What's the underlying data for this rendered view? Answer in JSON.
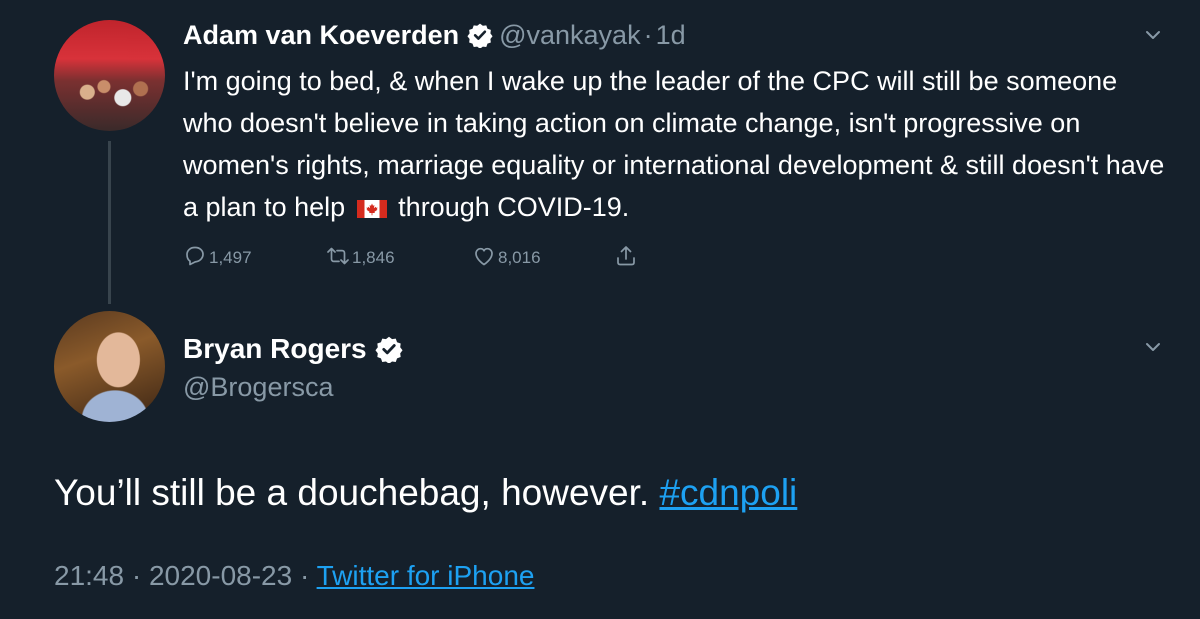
{
  "parent_tweet": {
    "display_name": "Adam van Koeverden",
    "handle": "@vankayak",
    "separator": "·",
    "time_ago": "1d",
    "text_before_flag": "I'm going to bed, & when I wake up the leader of the CPC will still be someone who doesn't believe in taking action on climate change, isn't progressive on women's rights, marriage equality or international development & still doesn't have a plan to help",
    "flag_icon": "canada-flag-icon",
    "text_after_flag": "through COVID-19.",
    "replies": "1,497",
    "retweets": "1,846",
    "likes": "8,016"
  },
  "reply_tweet": {
    "display_name": "Bryan Rogers",
    "handle": "@Brogersca",
    "text": "You’ll still be a douchebag, however.",
    "hashtag": "#cdnpoli",
    "time": "21:48",
    "separator1": "·",
    "date": "2020-08-23",
    "separator2": "·",
    "source": "Twitter for iPhone"
  },
  "colors": {
    "background": "#15202b",
    "text": "#ffffff",
    "muted": "#8899a6",
    "accent": "#1da1f2",
    "thread_line": "#38444d"
  }
}
